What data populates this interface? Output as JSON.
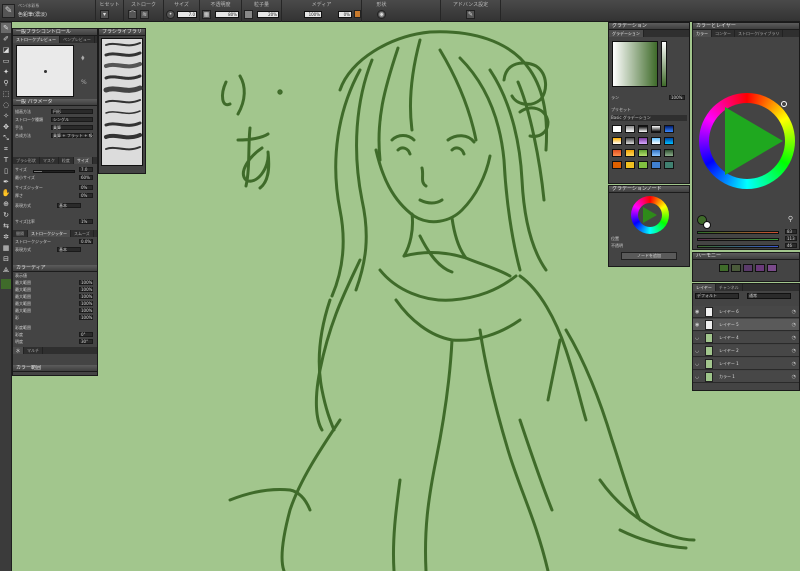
{
  "toolbar": {
    "tool_name": "ペン/水彩系",
    "tool_sub": "色鉛筆(濃淡)",
    "groups": [
      "ヒセット",
      "ストローク",
      "サイズ",
      "不透明度",
      "粒子量",
      "メディア",
      "形状",
      "アドバンス設定"
    ],
    "size_value": "7.0",
    "opacity_value": "80%",
    "grain_value": "20%",
    "media_value1": "100%",
    "media_value2": "0%"
  },
  "brush_panel": {
    "title": "一般ブラシコントロール",
    "tabs": [
      "ストロークプレビュー",
      "ペンプレビュー"
    ],
    "section_general": "一般",
    "section_general2": "パラメータ",
    "rows": [
      {
        "label": "描画方法",
        "value": "円形"
      },
      {
        "label": "ストローク種類",
        "value": "シングル"
      },
      {
        "label": "手法",
        "value": "乗算"
      },
      {
        "label": "合成方法",
        "value": "乗算 + フラット + 吸"
      }
    ],
    "tabs2": [
      "ブラシ形状",
      "マスク",
      "粒度",
      "サイズ"
    ],
    "size_rows": [
      {
        "label": "サイズ",
        "value": "7.0"
      },
      {
        "label": "最小サイズ",
        "value": "60%"
      },
      {
        "label": "サイズジッター",
        "value": "0%"
      },
      {
        "label": "厚さ",
        "value": "0%"
      },
      {
        "label": "表現方式",
        "value": "基本"
      },
      {
        "label": "サイズ比率",
        "value": "1%"
      }
    ],
    "stroke_tabs": [
      "間隔",
      "ストロークジッター",
      "スムーズ"
    ],
    "stroke_rows": [
      {
        "label": "ストロークジッター",
        "value": "0.0%"
      },
      {
        "label": "表現方式",
        "value": "基本"
      }
    ],
    "color_section": "カラーディア",
    "color_rows": [
      {
        "label": "表示値",
        "value": ""
      },
      {
        "label": "最大範囲",
        "value": "100%"
      },
      {
        "label": "最大範囲",
        "value": "100%"
      },
      {
        "label": "最大範囲",
        "value": "100%"
      },
      {
        "label": "最大範囲",
        "value": "100%"
      },
      {
        "label": "最大範囲",
        "value": "100%"
      },
      {
        "label": "彩",
        "value": "100%"
      },
      {
        "label": "彩度範囲",
        "value": ""
      },
      {
        "label": "彩度",
        "value": "0°"
      },
      {
        "label": "明度",
        "value": "30°"
      }
    ],
    "bottom_tabs": [
      "水",
      "マルチ"
    ],
    "bottom_section": "カラー範囲"
  },
  "brush_library": {
    "title": "ブラシライブラリ"
  },
  "gradient_panel": {
    "title": "グラデーション",
    "tab": "グラデーション",
    "opacity_label": "ラン",
    "opacity_value": "100%",
    "preset_label": "プリセット",
    "library_label": "Basic グラデーション"
  },
  "gradient_node_panel": {
    "title": "グラデーションノード",
    "button": "ノードを追加",
    "row1": "位置",
    "row2": "不透明"
  },
  "color_panel": {
    "title": "カラーとレイヤー",
    "tabs": [
      "カラー",
      "コンター",
      "ストローク/ライブラリ"
    ],
    "r": "83",
    "g": "113",
    "b": "46"
  },
  "harmony_panel": {
    "title": "ハーモニー"
  },
  "layer_panel": {
    "title": "レイヤー",
    "tabs": [
      "レイヤー",
      "チャンネル"
    ],
    "blend": "デフォルト",
    "mode": "通常",
    "layers": [
      {
        "name": "レイヤー 6",
        "white": true,
        "selected": false
      },
      {
        "name": "レイヤー 5",
        "white": true,
        "selected": true
      },
      {
        "name": "レイヤー 4",
        "white": false,
        "selected": false
      },
      {
        "name": "レイヤー 2",
        "white": false,
        "selected": false
      },
      {
        "name": "レイヤー 1",
        "white": false,
        "selected": false
      },
      {
        "name": "カラー 1",
        "white": false,
        "selected": false
      }
    ]
  },
  "canvas": {
    "sketch_text1": "ゆ",
    "sketch_text2": "あ"
  },
  "colors": {
    "canvas": "#a2c68d",
    "stroke": "#3f6b2a",
    "panel": "#444444"
  }
}
